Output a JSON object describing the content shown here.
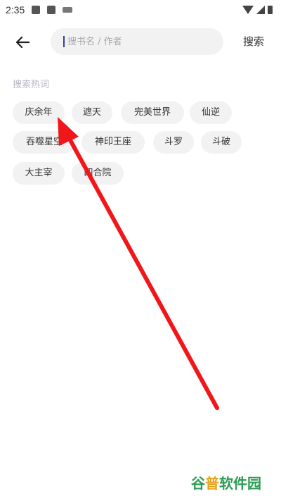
{
  "status_bar": {
    "time": "2:35"
  },
  "search": {
    "placeholder": "搜书名 / 作者",
    "button_label": "搜索"
  },
  "hot": {
    "title": "搜索热词",
    "tags": [
      "庆余年",
      "遮天",
      "完美世界",
      "仙逆",
      "吞噬星空",
      "神印王座",
      "斗罗",
      "斗破",
      "大主宰",
      "四合院"
    ]
  },
  "watermark": {
    "part1": "谷",
    "part2": "普",
    "part3": "软件园"
  },
  "colors": {
    "arrow": "#f0161a",
    "tag_bg": "#f2f2f2",
    "hint": "#b7b7c6"
  }
}
